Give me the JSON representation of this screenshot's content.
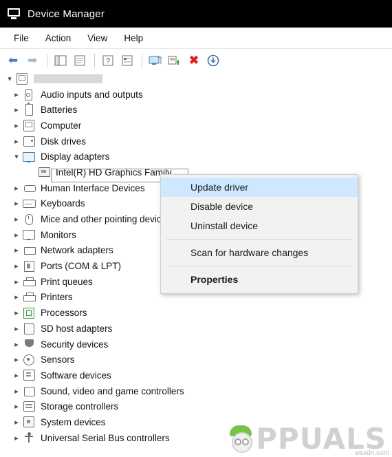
{
  "window": {
    "title": "Device Manager",
    "icon": "device-manager-icon"
  },
  "menubar": {
    "items": [
      {
        "label": "File"
      },
      {
        "label": "Action"
      },
      {
        "label": "View"
      },
      {
        "label": "Help"
      }
    ]
  },
  "toolbar": {
    "buttons": [
      {
        "name": "back-button",
        "glyph": "⇦"
      },
      {
        "name": "forward-button",
        "glyph": "⇨"
      },
      {
        "name": "show-hide-console-tree-button",
        "glyph": "tree"
      },
      {
        "name": "properties-button",
        "glyph": "properties"
      },
      {
        "name": "help-button",
        "glyph": "?"
      },
      {
        "name": "view-devices-button",
        "glyph": "view"
      },
      {
        "name": "scan-hardware-changes-button",
        "glyph": "scan"
      },
      {
        "name": "update-driver-button",
        "glyph": "update"
      },
      {
        "name": "uninstall-device-button",
        "glyph": "✖"
      },
      {
        "name": "disable-device-button",
        "glyph": "↓"
      }
    ]
  },
  "tree": {
    "root": {
      "label": "",
      "redacted": true,
      "expanded": true
    },
    "items": [
      {
        "label": "Audio inputs and outputs",
        "icon": "speaker-icon",
        "expanded": false
      },
      {
        "label": "Batteries",
        "icon": "battery-icon",
        "expanded": false
      },
      {
        "label": "Computer",
        "icon": "computer-icon",
        "expanded": false
      },
      {
        "label": "Disk drives",
        "icon": "disk-drive-icon",
        "expanded": false
      },
      {
        "label": "Display adapters",
        "icon": "display-adapter-icon",
        "expanded": true
      },
      {
        "label": "Intel(R) HD Graphics Family",
        "icon": "gpu-icon",
        "child": true,
        "selected": true
      },
      {
        "label": "Human Interface Devices",
        "icon": "hid-icon",
        "expanded": false
      },
      {
        "label": "Keyboards",
        "icon": "keyboard-icon",
        "expanded": false
      },
      {
        "label": "Mice and other pointing devices",
        "icon": "mouse-icon",
        "expanded": false
      },
      {
        "label": "Monitors",
        "icon": "monitor-icon",
        "expanded": false
      },
      {
        "label": "Network adapters",
        "icon": "network-adapter-icon",
        "expanded": false
      },
      {
        "label": "Ports (COM & LPT)",
        "icon": "port-icon",
        "expanded": false
      },
      {
        "label": "Print queues",
        "icon": "printer-icon",
        "expanded": false
      },
      {
        "label": "Printers",
        "icon": "printer-icon",
        "expanded": false
      },
      {
        "label": "Processors",
        "icon": "processor-icon",
        "expanded": false
      },
      {
        "label": "SD host adapters",
        "icon": "sd-card-icon",
        "expanded": false
      },
      {
        "label": "Security devices",
        "icon": "shield-icon",
        "expanded": false
      },
      {
        "label": "Sensors",
        "icon": "sensor-icon",
        "expanded": false
      },
      {
        "label": "Software devices",
        "icon": "software-device-icon",
        "expanded": false
      },
      {
        "label": "Sound, video and game controllers",
        "icon": "sound-controller-icon",
        "expanded": false
      },
      {
        "label": "Storage controllers",
        "icon": "storage-controller-icon",
        "expanded": false
      },
      {
        "label": "System devices",
        "icon": "system-device-icon",
        "expanded": false
      },
      {
        "label": "Universal Serial Bus controllers",
        "icon": "usb-controller-icon",
        "expanded": false
      }
    ]
  },
  "context_menu": {
    "items": [
      {
        "label": "Update driver",
        "highlighted": true,
        "bold": false
      },
      {
        "label": "Disable device",
        "highlighted": false,
        "bold": false
      },
      {
        "label": "Uninstall device",
        "highlighted": false,
        "bold": false
      },
      {
        "separator": true
      },
      {
        "label": "Scan for hardware changes",
        "highlighted": false,
        "bold": false
      },
      {
        "separator": true
      },
      {
        "label": "Properties",
        "highlighted": false,
        "bold": true
      }
    ],
    "highlight_color": "#cde8ff"
  },
  "watermark": {
    "brand": "PPUALS",
    "source": "wsxdn.com"
  }
}
